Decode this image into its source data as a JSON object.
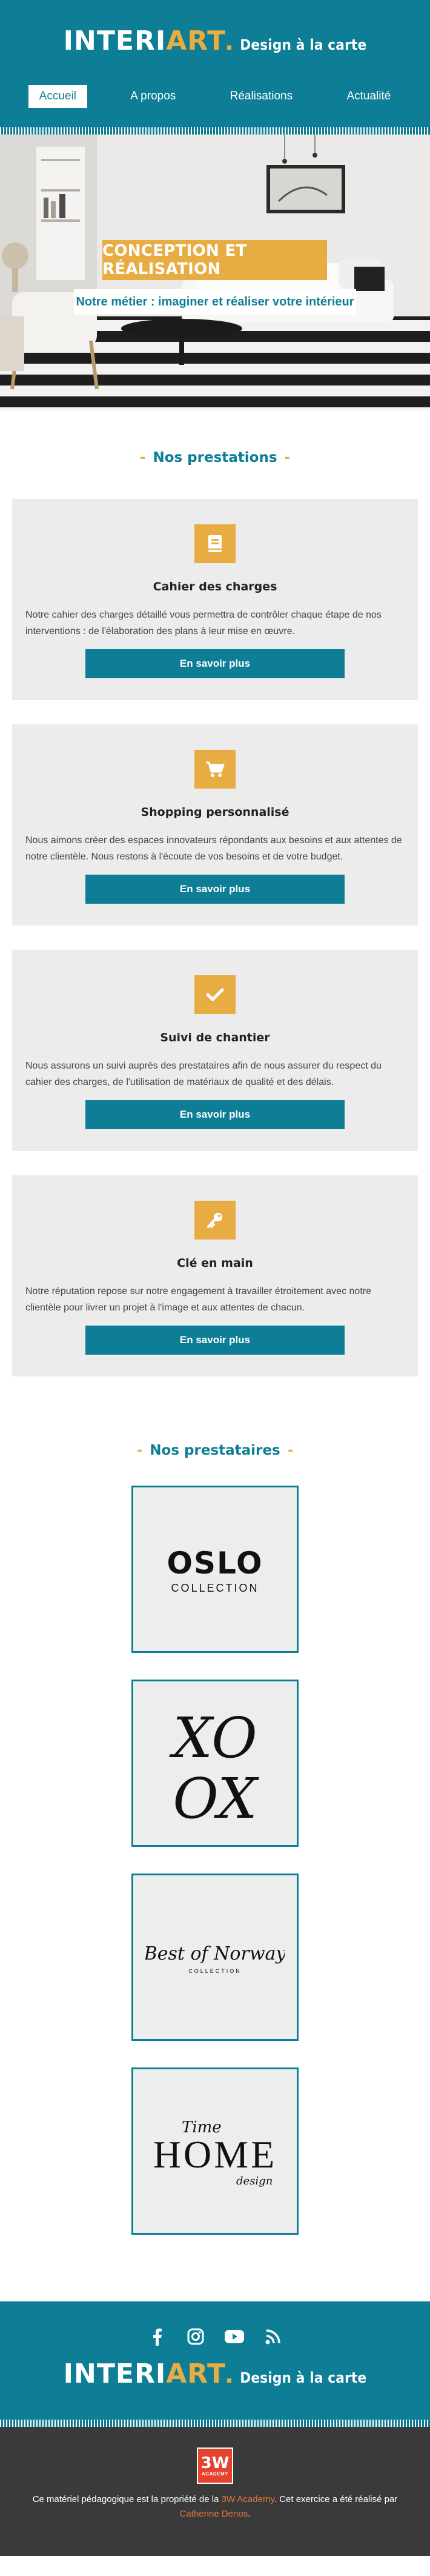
{
  "header": {
    "logo_part1": "INTERI",
    "logo_part2": "ART",
    "tagline": "Design à la carte"
  },
  "nav": {
    "items": [
      {
        "label": "Accueil",
        "active": true
      },
      {
        "label": "A propos",
        "active": false
      },
      {
        "label": "Réalisations",
        "active": false
      },
      {
        "label": "Actualité",
        "active": false
      }
    ]
  },
  "hero": {
    "title": "CONCEPTION ET RÉALISATION",
    "subtitle": "Notre métier : imaginer et réaliser votre intérieur"
  },
  "services": {
    "title": "Nos prestations",
    "button_label": "En savoir plus",
    "items": [
      {
        "icon": "book-icon",
        "title": "Cahier des charges",
        "text": "Notre cahier des charges détaillé vous permettra de contrôler chaque étape de nos interventions : de l'élaboration des plans à leur mise en œuvre."
      },
      {
        "icon": "shopping-cart-icon",
        "title": "Shopping personnalisé",
        "text": "Nous aimons créer des espaces innovateurs répondants aux besoins et aux attentes de notre clientèle. Nous restons à l'écoute de vos besoins et de votre budget."
      },
      {
        "icon": "checkmark-icon",
        "title": "Suivi de chantier",
        "text": "Nous assurons un suivi auprès des prestataires afin de nous assurer du respect du cahier des charges, de l'utilisation de matériaux de qualité et des délais."
      },
      {
        "icon": "key-icon",
        "title": "Clé en main",
        "text": "Notre réputation repose sur notre engagement à travailler étroitement avec notre clientèle pour livrer un projet à l'image et aux attentes de chacun."
      }
    ]
  },
  "partners": {
    "title": "Nos prestataires",
    "items": [
      {
        "line1": "OSLO",
        "line2": "COLLECTION"
      },
      {
        "line1": "XO",
        "line2": "OX"
      },
      {
        "line1": "Best of Norway",
        "line2": "COLLECTION"
      },
      {
        "line1": "HOME",
        "line2": "Time",
        "line3": "design"
      }
    ]
  },
  "footer": {
    "social": [
      "facebook-icon",
      "instagram-icon",
      "youtube-icon",
      "rss-icon"
    ],
    "badge_main": "3W",
    "badge_sub": "ACADEMY",
    "credits_prefix": "Ce matériel pédagogique est la propriété de la ",
    "credits_link1": "3W Academy",
    "credits_middle": ". Cet exercice a été réalisé par ",
    "credits_link2": "Catherine Denos",
    "credits_suffix": "."
  },
  "colors": {
    "primary": "#0e7e97",
    "accent": "#e8ad42",
    "card_bg": "#ececec",
    "footer_dark": "#3a3a3a",
    "link": "#e8763f"
  }
}
